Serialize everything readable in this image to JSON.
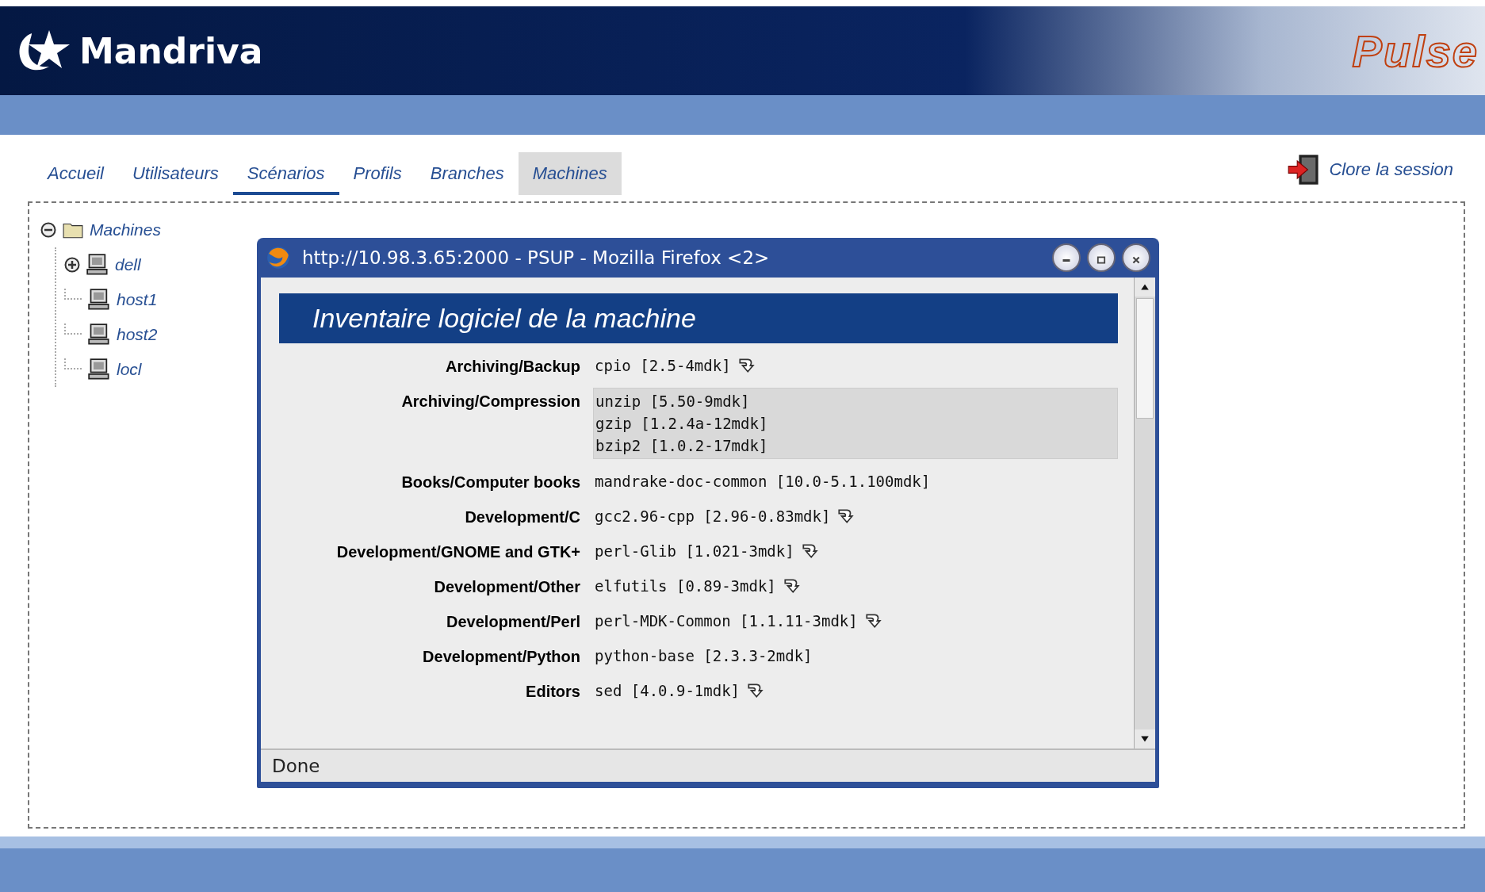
{
  "header": {
    "brand": "Mandriva",
    "product": "Pulse"
  },
  "nav": {
    "tabs": [
      {
        "label": "Accueil",
        "selected": false,
        "highlighted": false
      },
      {
        "label": "Utilisateurs",
        "selected": false,
        "highlighted": false
      },
      {
        "label": "Scénarios",
        "selected": true,
        "highlighted": false
      },
      {
        "label": "Profils",
        "selected": false,
        "highlighted": false
      },
      {
        "label": "Branches",
        "selected": false,
        "highlighted": false
      },
      {
        "label": "Machines",
        "selected": false,
        "highlighted": true
      }
    ],
    "logout": "Clore la session"
  },
  "tree": [
    {
      "label": "Machines",
      "kind": "folder",
      "expanded": true,
      "children": [
        {
          "label": "dell",
          "kind": "computer",
          "expanded": false
        },
        {
          "label": "host1",
          "kind": "computer"
        },
        {
          "label": "host2",
          "kind": "computer"
        },
        {
          "label": "locl",
          "kind": "computer"
        }
      ]
    }
  ],
  "popup": {
    "title": "http://10.98.3.65:2000 - PSUP - Mozilla Firefox <2>",
    "heading": "Inventaire logiciel de la machine",
    "rows": [
      {
        "category": "Archiving/Backup",
        "highlighted": false,
        "packages": [
          {
            "name": "cpio [2.5-4mdk]",
            "update": true
          }
        ]
      },
      {
        "category": "Archiving/Compression",
        "highlighted": true,
        "packages": [
          {
            "name": "unzip [5.50-9mdk]",
            "update": false
          },
          {
            "name": "gzip [1.2.4a-12mdk]",
            "update": false
          },
          {
            "name": "bzip2 [1.0.2-17mdk]",
            "update": false
          }
        ]
      },
      {
        "category": "Books/Computer books",
        "highlighted": false,
        "packages": [
          {
            "name": "mandrake-doc-common [10.0-5.1.100mdk]",
            "update": false
          }
        ]
      },
      {
        "category": "Development/C",
        "highlighted": false,
        "packages": [
          {
            "name": "gcc2.96-cpp [2.96-0.83mdk]",
            "update": true
          }
        ]
      },
      {
        "category": "Development/GNOME and GTK+",
        "highlighted": false,
        "packages": [
          {
            "name": "perl-Glib [1.021-3mdk]",
            "update": true
          }
        ]
      },
      {
        "category": "Development/Other",
        "highlighted": false,
        "packages": [
          {
            "name": "elfutils [0.89-3mdk]",
            "update": true
          }
        ]
      },
      {
        "category": "Development/Perl",
        "highlighted": false,
        "packages": [
          {
            "name": "perl-MDK-Common [1.1.11-3mdk]",
            "update": true
          }
        ]
      },
      {
        "category": "Development/Python",
        "highlighted": false,
        "packages": [
          {
            "name": "python-base [2.3.3-2mdk]",
            "update": false
          }
        ]
      },
      {
        "category": "Editors",
        "highlighted": false,
        "packages": [
          {
            "name": "sed [4.0.9-1mdk]",
            "update": true
          }
        ]
      }
    ],
    "status": "Done"
  }
}
